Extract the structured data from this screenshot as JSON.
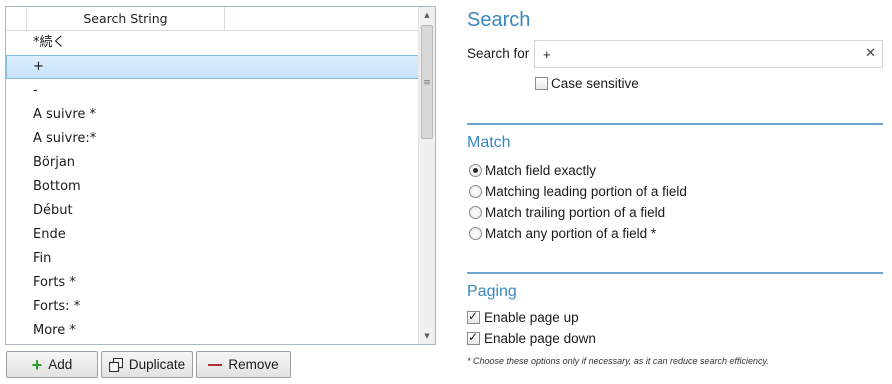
{
  "list": {
    "column_header": "Search String",
    "items": [
      "*続く",
      "+",
      "-",
      "A suivre *",
      "A suivre:*",
      "Början",
      "Bottom",
      "Début",
      "Ende",
      "Fin",
      "Forts *",
      "Forts: *",
      "More *"
    ],
    "selected_index": 1
  },
  "buttons": {
    "add_label": "Add",
    "duplicate_label": "Duplicate",
    "remove_label": "Remove"
  },
  "search": {
    "title": "Search",
    "search_for_label": "Search for",
    "search_value": "+",
    "clear_glyph": "✕",
    "case_sensitive_label": "Case sensitive",
    "case_sensitive_checked": false
  },
  "match": {
    "title": "Match",
    "options": [
      "Match field exactly",
      "Matching leading portion of a field",
      "Match trailing portion of a field",
      "Match any portion of a field *"
    ],
    "selected_index": 0
  },
  "paging": {
    "title": "Paging",
    "enable_page_up_label": "Enable page up",
    "enable_page_up_checked": true,
    "enable_page_down_label": "Enable page down",
    "enable_page_down_checked": true
  },
  "footnote": "* Choose these options only if necessary, as it can reduce search efficiency.",
  "icons": {
    "add": "plus-icon",
    "duplicate": "duplicate-icon",
    "remove": "minus-icon",
    "clear": "close-icon"
  },
  "colors": {
    "accent": "#3a87bf",
    "selection": "#c7e3fa",
    "separator": "#6fa3cc"
  }
}
